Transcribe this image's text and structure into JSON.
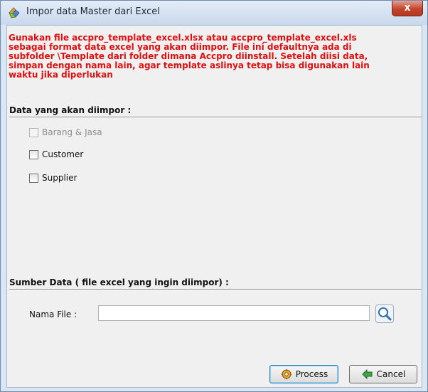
{
  "window": {
    "title": "Impor data Master dari Excel",
    "close_label": "x",
    "close_color": "#c2452d"
  },
  "notice": {
    "text": "Gunakan file accpro_template_excel.xlsx atau accpro_template_excel.xls\nsebagai format data excel yang akan diimpor. File ini defaultnya ada di\nsubfolder \\Template dari folder dimana Accpro diinstall. Setelah diisi data,\nsimpan dengan nama lain, agar template aslinya tetap bisa digunakan lain\nwaktu jika diperlukan",
    "color": "#e01010"
  },
  "import_section": {
    "label": "Data yang akan diimpor :",
    "options": [
      {
        "label": "Barang & Jasa",
        "checked": false,
        "enabled": false
      },
      {
        "label": "Customer",
        "checked": false,
        "enabled": true
      },
      {
        "label": "Supplier",
        "checked": false,
        "enabled": true
      }
    ]
  },
  "source_section": {
    "label": "Sumber Data ( file excel yang ingin diimpor) :",
    "file_label": "Nama File :",
    "file_value": "",
    "browse_icon": "magnifier-icon"
  },
  "buttons": {
    "process_label": "Process",
    "process_icon": "gear-icon",
    "cancel_label": "Cancel",
    "cancel_icon": "back-arrow-icon"
  }
}
